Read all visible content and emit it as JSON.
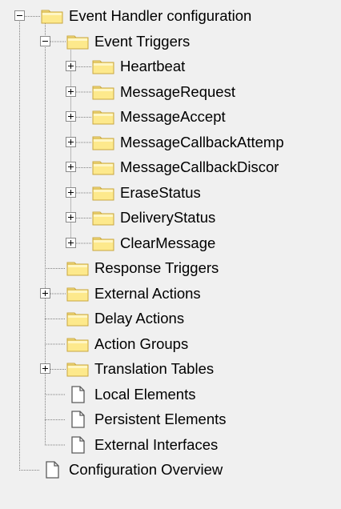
{
  "tree": {
    "root": {
      "label": "Event Handler configuration",
      "expanded": true,
      "icon": "folder-icon",
      "children": [
        {
          "label": "Event Triggers",
          "expanded": true,
          "icon": "folder-icon",
          "children": [
            {
              "label": "Heartbeat",
              "icon": "folder-icon",
              "expandable": true
            },
            {
              "label": "MessageRequest",
              "icon": "folder-icon",
              "expandable": true
            },
            {
              "label": "MessageAccept",
              "icon": "folder-icon",
              "expandable": true
            },
            {
              "label": "MessageCallbackAttemp",
              "icon": "folder-icon",
              "expandable": true
            },
            {
              "label": "MessageCallbackDiscor",
              "icon": "folder-icon",
              "expandable": true
            },
            {
              "label": "EraseStatus",
              "icon": "folder-icon",
              "expandable": true
            },
            {
              "label": "DeliveryStatus",
              "icon": "folder-icon",
              "expandable": true
            },
            {
              "label": "ClearMessage",
              "icon": "folder-icon",
              "expandable": true
            }
          ]
        },
        {
          "label": "Response Triggers",
          "icon": "folder-icon",
          "expandable": false
        },
        {
          "label": "External Actions",
          "icon": "folder-icon",
          "expandable": true
        },
        {
          "label": "Delay Actions",
          "icon": "folder-icon",
          "expandable": false
        },
        {
          "label": "Action Groups",
          "icon": "folder-icon",
          "expandable": false
        },
        {
          "label": "Translation Tables",
          "icon": "folder-icon",
          "expandable": true
        },
        {
          "label": "Local Elements",
          "icon": "document-icon",
          "expandable": false
        },
        {
          "label": "Persistent Elements",
          "icon": "document-icon",
          "expandable": false
        },
        {
          "label": "External Interfaces",
          "icon": "document-icon",
          "expandable": false
        }
      ]
    },
    "second_root": {
      "label": "Configuration Overview",
      "icon": "document-icon",
      "expandable": false
    }
  },
  "colors": {
    "folder_fill": "#fde98c",
    "folder_edge": "#c9a640",
    "document_fill": "#ffffff",
    "document_edge": "#5a5a5a",
    "connector": "#808080"
  }
}
